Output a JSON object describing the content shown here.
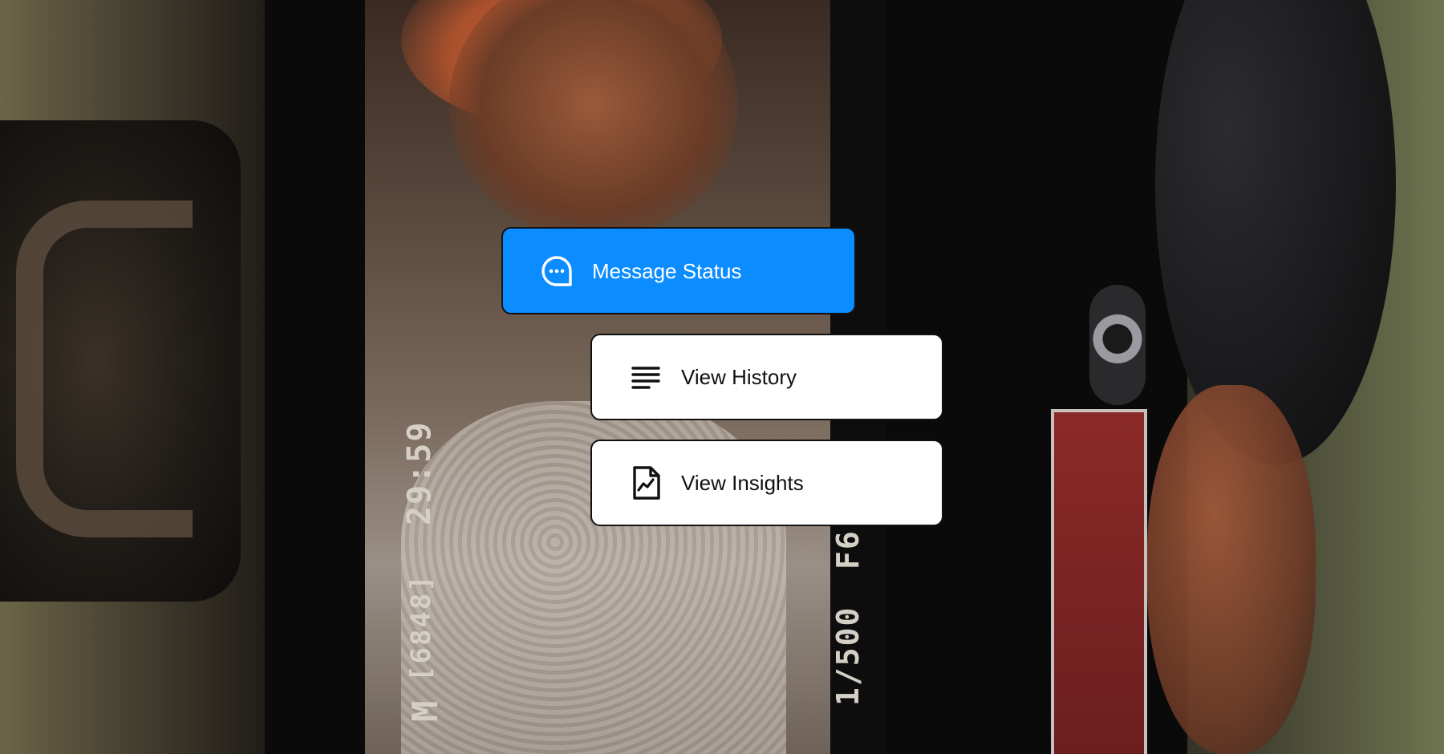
{
  "background": {
    "screen_readouts": {
      "time_remaining": "29:59",
      "shots_remaining": "[6848]",
      "mode": "M",
      "shutter": "1/500",
      "aperture": "F6"
    }
  },
  "menu": {
    "items": [
      {
        "label": "Message Status",
        "icon": "chat-bubble-icon"
      },
      {
        "label": "View History",
        "icon": "list-lines-icon"
      },
      {
        "label": "View Insights",
        "icon": "document-chart-icon"
      }
    ]
  },
  "colors": {
    "primary": "#0b8cff",
    "card_bg": "#ffffff",
    "text_dark": "#111111",
    "text_light": "#ffffff"
  }
}
